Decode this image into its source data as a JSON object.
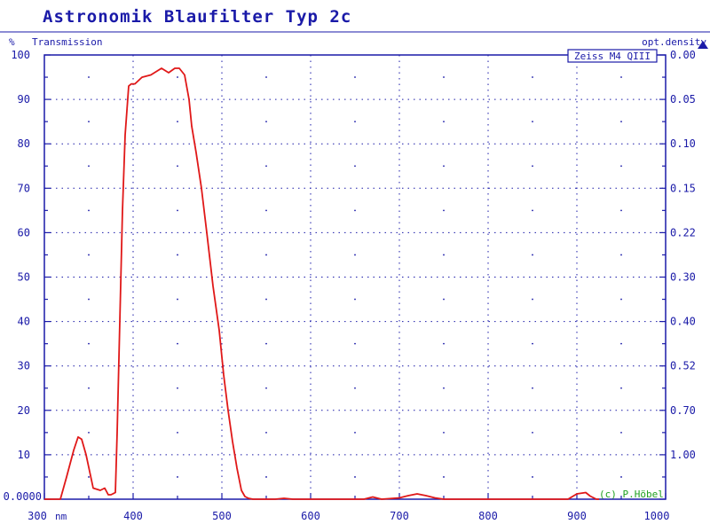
{
  "chart_data": {
    "type": "line",
    "title": "Astronomik Blaufilter Typ 2c",
    "ylabel": "Transmission",
    "yunit": "%",
    "xunit": "nm",
    "y2label": "opt.density",
    "xlim": [
      300,
      1000
    ],
    "ylim": [
      0,
      100
    ],
    "x_ticks": [
      "300",
      "400",
      "500",
      "600",
      "700",
      "800",
      "900",
      "1000"
    ],
    "y_ticks": [
      "0.0000",
      "10",
      "20",
      "30",
      "40",
      "50",
      "60",
      "70",
      "80",
      "90",
      "100"
    ],
    "y2_ticks": [
      "0.00",
      "0.05",
      "0.10",
      "0.15",
      "0.22",
      "0.30",
      "0.40",
      "0.52",
      "0.70",
      "1.00"
    ],
    "y2_tick_positions": [
      100,
      90,
      80,
      70,
      60,
      50,
      40,
      30,
      20,
      10
    ],
    "legend": "Zeiss M4 QIII",
    "annotation": "(c) P.Höbel",
    "grid": true,
    "colors": {
      "axes": "#1a1aa8",
      "line": "#e01818",
      "copyright": "#1fa01f"
    },
    "series": [
      {
        "x": [
          300,
          318,
          325,
          333,
          338,
          342,
          347,
          355,
          363,
          368,
          372,
          375,
          380,
          382,
          385,
          388,
          391,
          395,
          398,
          402,
          410,
          420,
          432,
          440,
          447,
          452,
          458,
          463,
          466,
          471,
          477,
          483,
          490,
          497,
          502,
          507,
          512,
          517,
          522,
          526,
          530,
          535,
          545,
          560,
          570,
          580,
          600,
          620,
          650,
          660,
          670,
          680,
          700,
          710,
          720,
          730,
          740,
          750,
          800,
          850,
          890,
          900,
          910,
          915,
          922,
          925
        ],
        "y": [
          0,
          0,
          5,
          11,
          14,
          13.5,
          10,
          2.5,
          2,
          2.5,
          1,
          1,
          1.5,
          15,
          40,
          65,
          82,
          93,
          93.5,
          93.5,
          95,
          95.5,
          97,
          96,
          97,
          97,
          95.5,
          90,
          84,
          78,
          70,
          60,
          48,
          38,
          28,
          20,
          13,
          7,
          2,
          0.6,
          0.2,
          0,
          0,
          0,
          0.2,
          0,
          0,
          0,
          0,
          0,
          0.5,
          0,
          0.3,
          0.8,
          1.2,
          0.8,
          0.3,
          0,
          0,
          0,
          0,
          1.2,
          1.5,
          0.7,
          0,
          0
        ]
      }
    ]
  }
}
